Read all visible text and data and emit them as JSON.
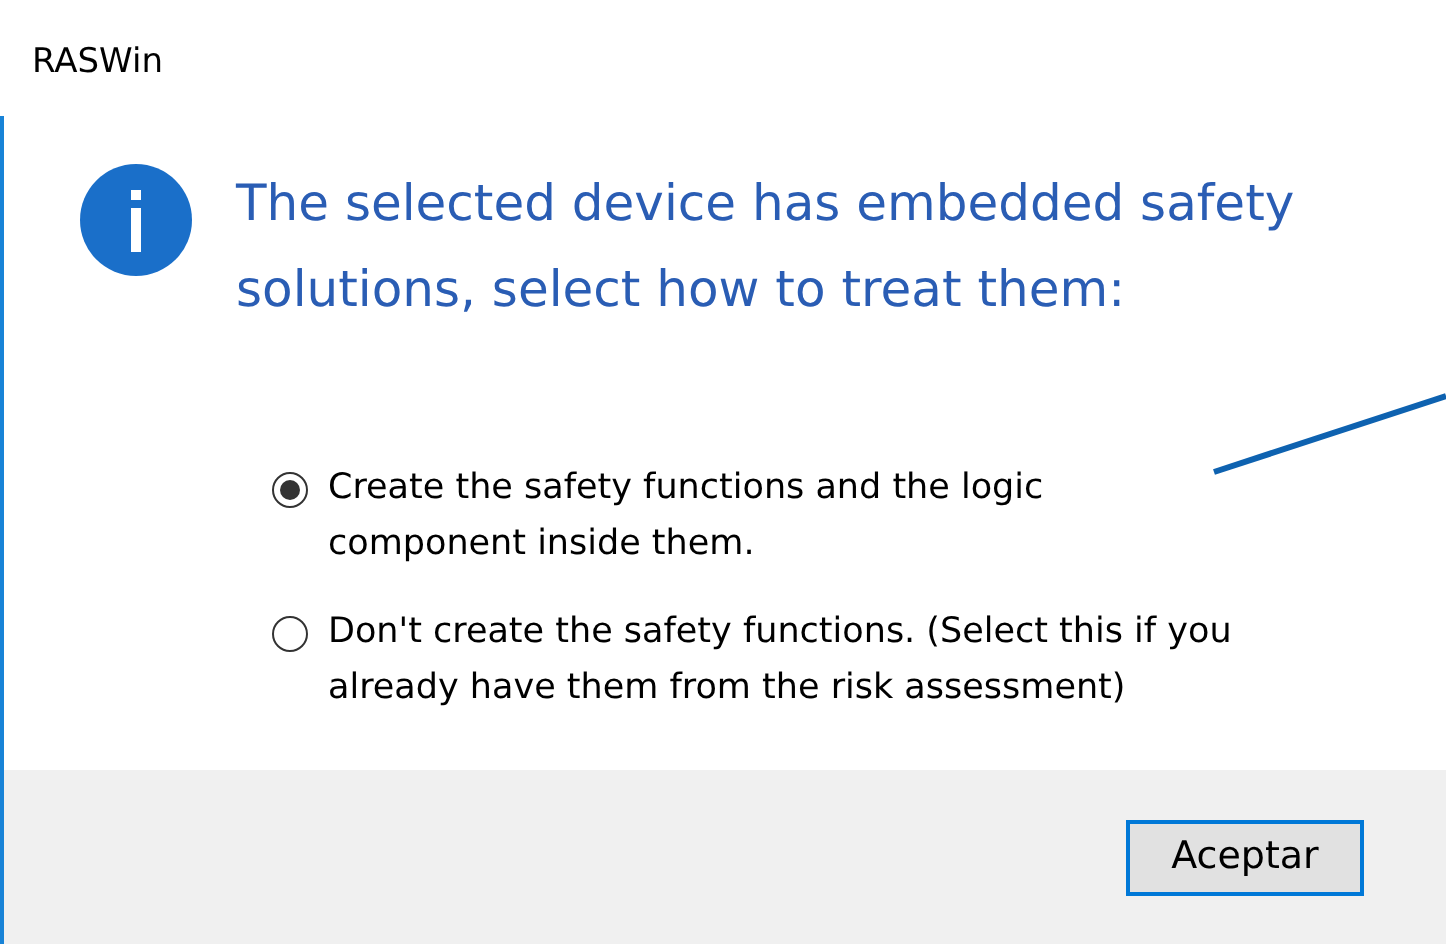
{
  "window": {
    "title": "RASWin"
  },
  "message": "The selected device has embedded safety solutions, select how to treat them:",
  "options": [
    {
      "label": "Create the safety functions and the logic component inside them.",
      "selected": true
    },
    {
      "label": "Don't create the safety functions. (Select this if you already have them from the risk assessment)",
      "selected": false
    }
  ],
  "buttons": [
    "Aceptar"
  ]
}
